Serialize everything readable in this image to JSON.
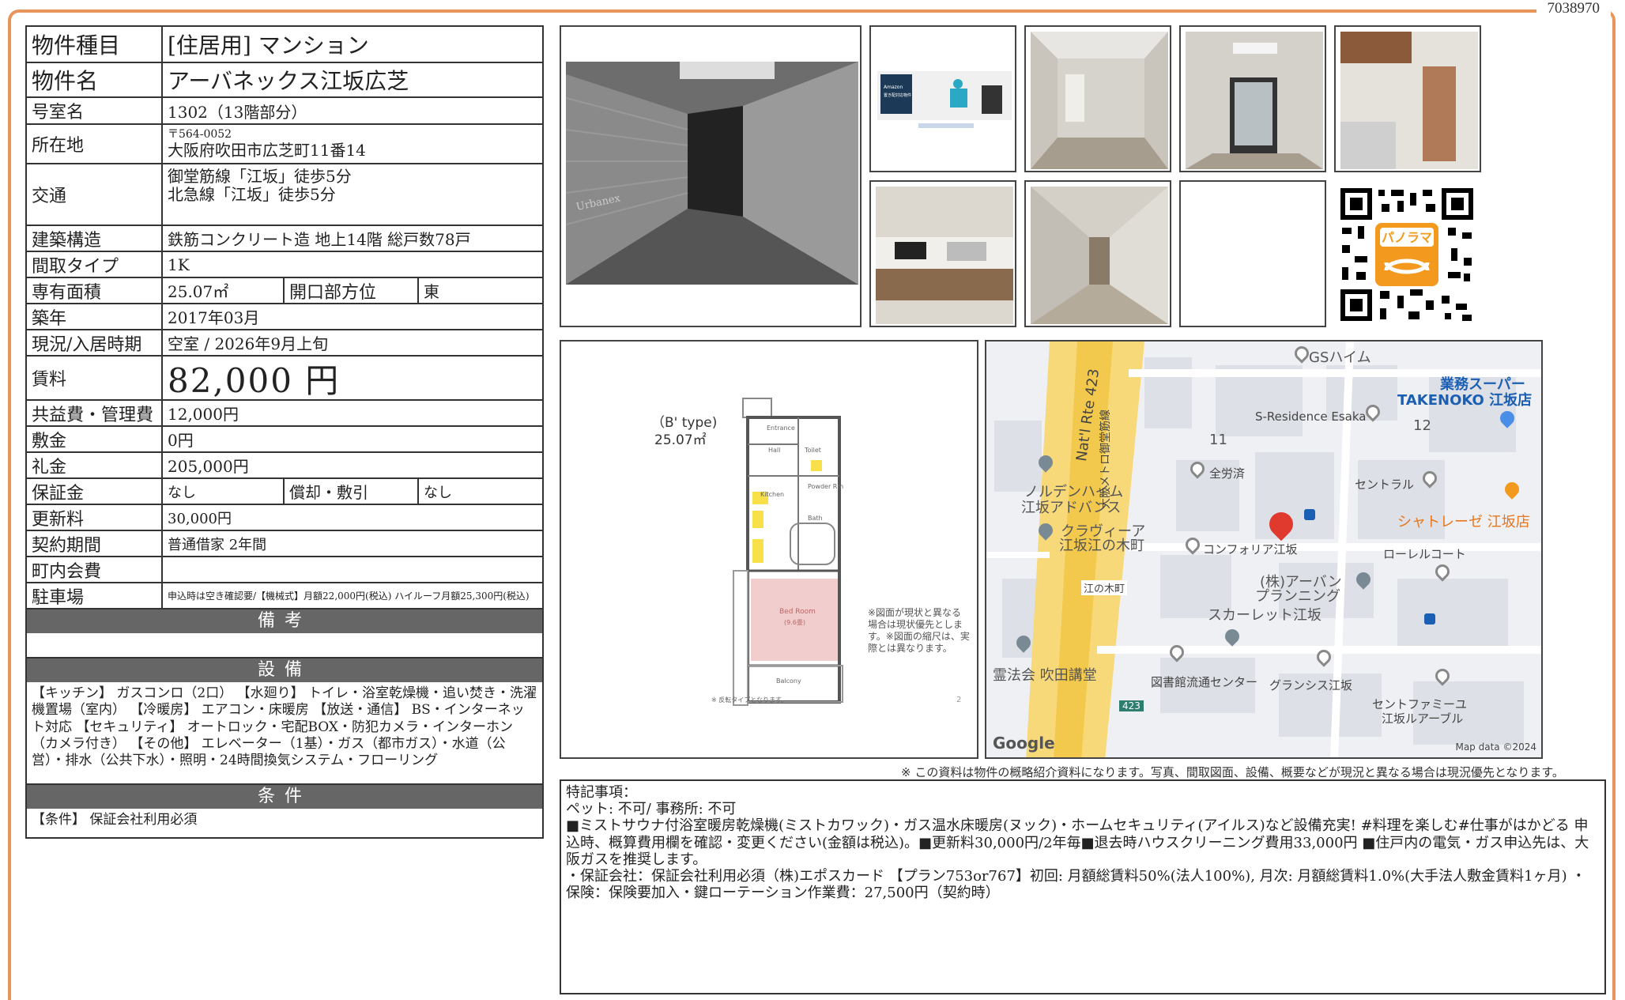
{
  "doc_id": "7038970",
  "spec": {
    "type_label": "物件種目",
    "type_value": "[住居用]  マンション",
    "name_label": "物件名",
    "name_value": "アーバネックス江坂広芝",
    "room_label": "号室名",
    "room_value": "1302（13階部分）",
    "address_label": "所在地",
    "postal": "〒564-0052",
    "address": "大阪府吹田市広芝町11番14",
    "transit_label": "交通",
    "transit_1": "御堂筋線「江坂」徒歩5分",
    "transit_2": "北急線「江坂」徒歩5分",
    "structure_label": "建築構造",
    "structure_value": "鉄筋コンクリート造  地上14階  総戸数78戸",
    "layout_label": "間取タイプ",
    "layout_value": "1K",
    "area_label": "専有面積",
    "area_value": "25.07㎡",
    "direction_label": "開口部方位",
    "direction_value": "東",
    "built_label": "築年",
    "built_value": "2017年03月",
    "status_label": "現況/入居時期",
    "status_value": "空室  /   2026年9月上旬",
    "rent_label": "賃料",
    "rent_value": "82,000 円",
    "fee_label": "共益費・管理費",
    "fee_value": "12,000円",
    "deposit_label": "敷金",
    "deposit_value": "0円",
    "keymoney_label": "礼金",
    "keymoney_value": "205,000円",
    "guarantee_label": "保証金",
    "guarantee_value": "なし",
    "amort_label": "償却・敷引",
    "amort_value": "なし",
    "renewal_label": "更新料",
    "renewal_value": "30,000円",
    "contract_label": "契約期間",
    "contract_value": "普通借家  2年間",
    "community_label": "町内会費",
    "community_value": "",
    "parking_label": "駐車場",
    "parking_value": "申込時は空き確認要/【機械式】月額22,000円(税込) ハイルーフ月額25,300円(税込)"
  },
  "bikou": {
    "title": "備考",
    "body": ""
  },
  "setsubi": {
    "title": "設備",
    "body": "【キッチン】 ガスコンロ（2口）  【水廻り】 トイレ・浴室乾燥機・追い焚き・洗濯機置場（室内）  【冷暖房】 エアコン・床暖房 【放送・通信】 BS・インターネット対応 【セキュリティ】 オートロック・宅配BOX・防犯カメラ・インターホン（カメラ付き） 【その他】 エレベーター（1基）・ガス（都市ガス）・水道（公営）・排水（公共下水）・照明・24時間換気システム・フローリング"
  },
  "jouken": {
    "title": "条件",
    "body": "【条件】  保証会社利用必須"
  },
  "floorplan": {
    "type": "（B' type)",
    "area": "25.07㎡",
    "rooms": [
      "Entrance",
      "Hall",
      "Toilet",
      "Kitchen",
      "Powder Rm",
      "Bath",
      "Bed Room",
      "(9.6畳)",
      "Balcony"
    ],
    "caution": "※図面が現状と異なる場合は現状優先とします。※図面の縮尺は、実際とは異なります。",
    "footnote": "※ 反転タイプとなります。",
    "page": "2"
  },
  "photo_sign": "Urbanex",
  "amazon": {
    "line1": "Amazon",
    "line2": "置き配対応物件"
  },
  "qr_label": "パノラマ",
  "map": {
    "labels": [
      "GSハイム",
      "業務スーパー",
      "TAKENOKO 江坂店",
      "S-Residence Esaka",
      "11",
      "12",
      "全労済",
      "セントラル",
      "ノルデンハイム",
      "江坂アドバンス",
      "シャトレーゼ 江坂店",
      "クラヴィーア",
      "江坂江の木町",
      "コンフォリア江坂",
      "ローレルコート",
      "(株)アーバン",
      "プランニング",
      "江の木町",
      "スカーレット江坂",
      "霊法会 吹田講堂",
      "図書館流通センター",
      "グランシス江坂",
      "セントファミーユ",
      "江坂ルアーブル",
      "Nat'l Rte 423",
      "大阪メトロ御堂筋線",
      "423",
      "Google",
      "Map data ©2024"
    ]
  },
  "notice": "※  この資料は物件の概略紹介資料になります。写真、間取図面、設備、概要などが現況と異なる場合は現況優先となります。",
  "remarks": {
    "title": "特記事項：",
    "line1": "ペット: 不可/ 事務所: 不可",
    "line2": "■ミストサウナ付浴室暖房乾燥機(ミストカワック)・ガス温水床暖房(ヌック)・ホームセキュリティ(アイルス)など設備充実! #料理を楽しむ#仕事がはかどる  申込時、概算費用欄を確認・変更ください(金額は税込)。■更新料30,000円/2年毎■退去時ハウスクリーニング費用33,000円 ■住戸内の電気・ガス申込先は、大阪ガスを推奨します。",
    "line3": "・保証会社：保証会社利用必須（株)エポスカード  【プラン753or767】初回: 月額総賃料50%(法人100%), 月次: 月額総賃料1.0%(大手法人敷金賃料1ヶ月) ・保険：保険要加入・鍵ローテーション作業費：27,500円（契約時）"
  }
}
